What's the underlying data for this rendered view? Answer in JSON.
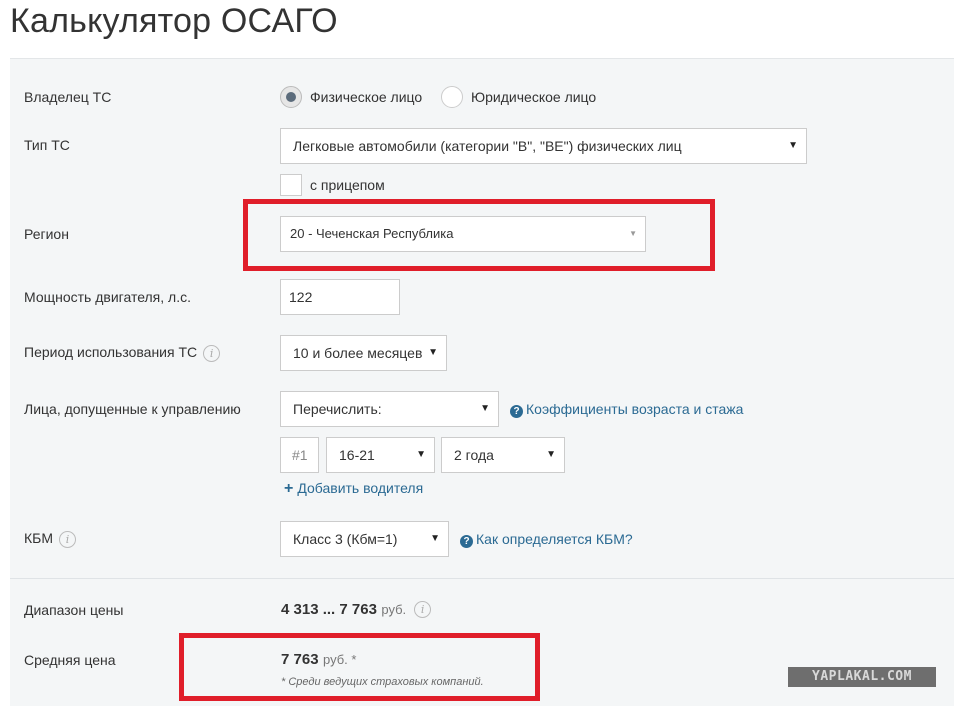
{
  "page": {
    "title": "Калькулятор ОСАГО"
  },
  "owner": {
    "label": "Владелец ТС",
    "options": [
      {
        "label": "Физическое лицо",
        "selected": true
      },
      {
        "label": "Юридическое лицо",
        "selected": false
      }
    ]
  },
  "vehicle_type": {
    "label": "Тип ТС",
    "value": "Легковые автомобили (категории \"B\", \"BE\") физических лиц",
    "trailer_label": "с прицепом",
    "trailer_checked": false
  },
  "region": {
    "label": "Регион",
    "value": "20 - Чеченская Республика"
  },
  "power": {
    "label": "Мощность двигателя, л.с.",
    "value": "122"
  },
  "period": {
    "label": "Период использования ТС",
    "value": "10 и более месяцев"
  },
  "drivers": {
    "label": "Лица, допущенные к управлению",
    "mode": "Перечислить:",
    "coef_link": "Коэффициенты возраста и стажа",
    "driver": {
      "number": "#1",
      "age": "16-21",
      "experience": "2 года"
    },
    "add_link": "Добавить водителя"
  },
  "kbm": {
    "label": "КБМ",
    "value": "Класс 3 (Кбм=1)",
    "link": "Как определяется КБМ?"
  },
  "result": {
    "range_label": "Диапазон цены",
    "range_value": "4 313 ... 7 763",
    "currency": "руб.",
    "avg_label": "Средняя цена",
    "avg_value": "7 763",
    "avg_currency": "руб. *",
    "footnote": "* Среди ведущих страховых компаний."
  },
  "watermark": "YAPLAKAL.COM",
  "colors": {
    "link": "#2b6a93",
    "highlight": "#e01e2a",
    "panel": "#f4f6f7"
  }
}
